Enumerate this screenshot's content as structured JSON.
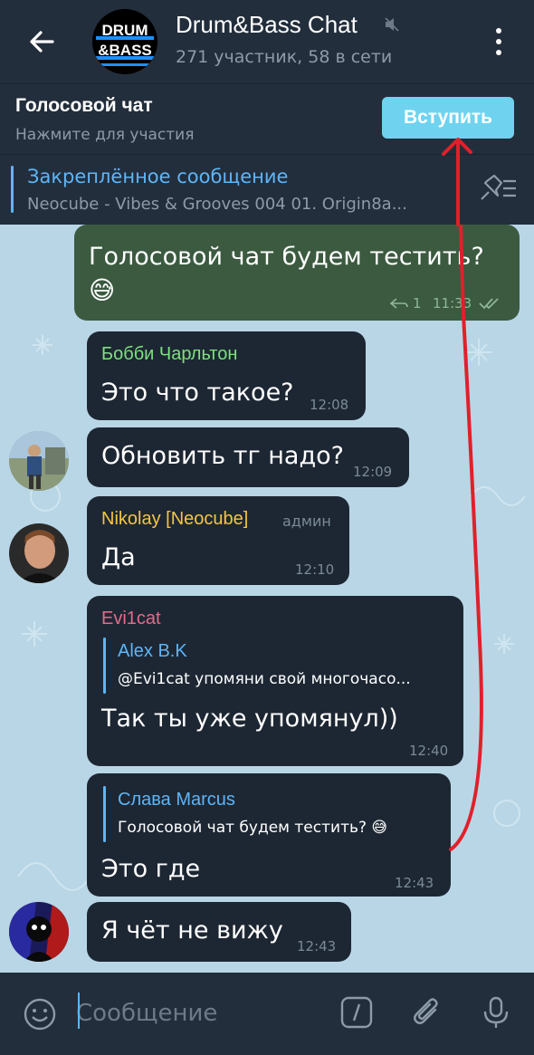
{
  "header": {
    "back_icon": "arrow-left-icon",
    "avatar_text_top": "DRUM",
    "avatar_text_bottom": "&BASS",
    "title": "Drum&Bass Chat",
    "mute_icon": "muted-speaker-icon",
    "subtitle": "271 участник, 58 в сети",
    "menu_icon": "more-vertical-icon"
  },
  "voice_chat": {
    "title": "Голосовой чат",
    "subtitle": "Нажмите для участия",
    "join_label": "Вступить",
    "join_color": "#6fd3f0"
  },
  "pinned": {
    "title": "Закреплённое сообщение",
    "text": "Neocube - Vibes & Grooves 004   01. Origin8a...",
    "icon": "pin-list-icon"
  },
  "messages": [
    {
      "text": "Голосовой чат будем тестить?",
      "emoji": "😅",
      "replies": "1",
      "time": "11:33",
      "status_icon": "double-check-icon"
    },
    {
      "sender": "Бобби Чарльтон",
      "sender_color": "#7ee07e",
      "text": "Это что такое?",
      "time": "12:08"
    },
    {
      "text": "Обновить тг надо?",
      "time": "12:09"
    },
    {
      "sender": "Nikolay [Neocube]",
      "sender_color": "#f5c542",
      "badge": "админ",
      "text": "Да",
      "time": "12:10"
    },
    {
      "sender": "Evi1cat",
      "sender_color": "#e56a8a",
      "reply_sender": "Alex B.K",
      "reply_text": "@Evi1cat упомяни свой многочасо...",
      "text": "Так ты уже упомянул))",
      "time": "12:40"
    },
    {
      "reply_sender": "Слава Marcus",
      "reply_text": "Голосовой чат будем тестить?",
      "reply_emoji": "😅",
      "text": "Это где",
      "time": "12:43"
    },
    {
      "text": "Я чёт не вижу",
      "time": "12:43"
    }
  ],
  "input": {
    "placeholder": "Сообщение",
    "emoji_icon": "smile-icon",
    "command_icon": "slash-command-icon",
    "attach_icon": "paperclip-icon",
    "mic_icon": "microphone-icon"
  },
  "annotation_color": "#e0202a"
}
